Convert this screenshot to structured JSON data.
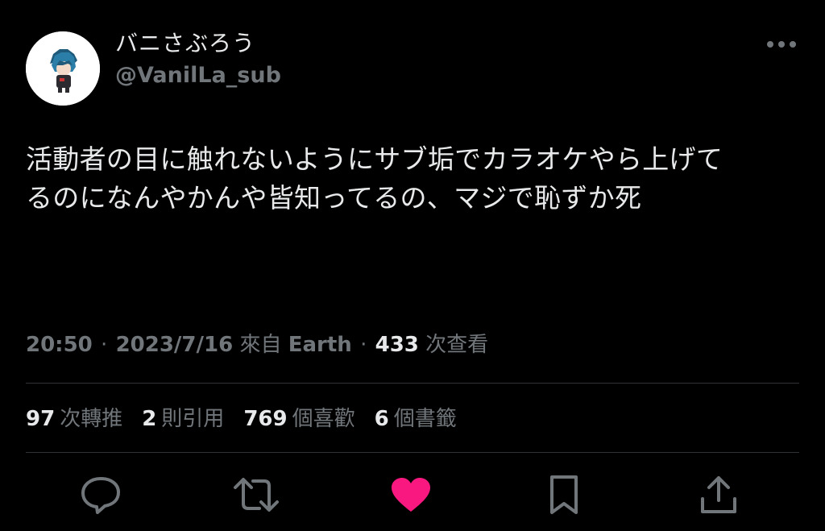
{
  "user": {
    "display_name": "バニさぶろう",
    "handle": "@VanilLa_sub"
  },
  "tweet": {
    "text_lines": [
      "活動者の目に触れないようにサブ垢でカラオケやら上げて",
      "るのになんやかんや皆知ってるの、マジで恥ずか死"
    ]
  },
  "meta": {
    "time": "20:50",
    "separator": "·",
    "date": "2023/7/16",
    "source_prefix": "來自",
    "source": "Earth",
    "views_count": "433",
    "views_label": "次查看"
  },
  "stats": [
    {
      "num": "97",
      "label": "次轉推"
    },
    {
      "num": "2",
      "label": "則引用"
    },
    {
      "num": "769",
      "label": "個喜歡"
    },
    {
      "num": "6",
      "label": "個書籤"
    }
  ],
  "colors": {
    "background": "#000000",
    "text_primary": "#e7e9ea",
    "text_secondary": "#71767b",
    "divider": "#2f3336",
    "like_active": "#f91880"
  },
  "icons": {
    "more": "more-horizontal-icon",
    "reply": "reply-icon",
    "retweet": "retweet-icon",
    "like": "heart-filled-icon",
    "bookmark": "bookmark-icon",
    "share": "share-icon"
  }
}
